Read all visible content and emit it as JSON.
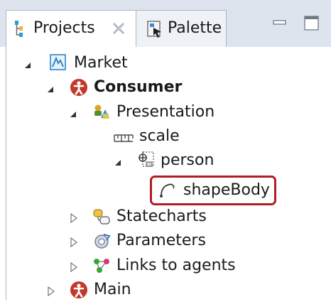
{
  "tabs": {
    "projects": {
      "label": "Projects",
      "icon": "projects-icon",
      "close_glyph": "close-icon"
    },
    "palette": {
      "label": "Palette",
      "icon": "palette-icon"
    }
  },
  "window_controls": {
    "minimize": "minimize-icon",
    "maximize": "maximize-icon"
  },
  "tree": {
    "nodes": [
      {
        "label": "Market",
        "icon": "model-icon",
        "expanded": true,
        "bold": false
      },
      {
        "label": "Consumer",
        "icon": "agent-icon",
        "expanded": true,
        "bold": true
      },
      {
        "label": "Presentation",
        "icon": "presentation-icon",
        "expanded": true,
        "bold": false
      },
      {
        "label": "scale",
        "icon": "scale-icon",
        "expanded": null,
        "bold": false
      },
      {
        "label": "person",
        "icon": "group-icon",
        "expanded": true,
        "bold": false
      },
      {
        "label": "shapeBody",
        "icon": "curve-shape-icon",
        "expanded": null,
        "bold": false,
        "highlighted": true
      },
      {
        "label": "Statecharts",
        "icon": "statecharts-icon",
        "expanded": false,
        "bold": false
      },
      {
        "label": "Parameters",
        "icon": "parameters-icon",
        "expanded": false,
        "bold": false
      },
      {
        "label": "Links to agents",
        "icon": "links-icon",
        "expanded": false,
        "bold": false
      },
      {
        "label": "Main",
        "icon": "agent-icon",
        "expanded": false,
        "bold": false
      }
    ]
  },
  "colors": {
    "highlight_border": "#b01e23",
    "agent_red": "#c0392b",
    "tab_bar": "#dde4ee"
  }
}
